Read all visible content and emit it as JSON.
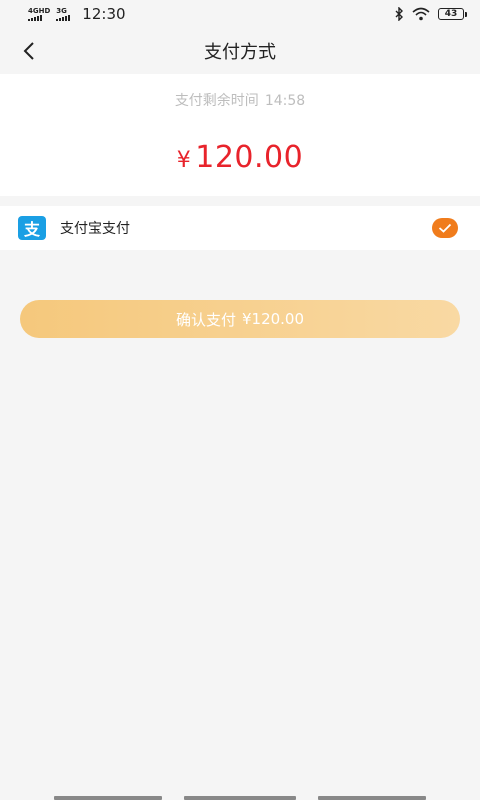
{
  "status_bar": {
    "network_1": "4GHD",
    "network_2": "3G",
    "time": "12:30",
    "battery": "43"
  },
  "navbar": {
    "title": "支付方式",
    "back_icon": "chevron-left-icon"
  },
  "payment": {
    "countdown_label": "支付剩余时间",
    "countdown_value": "14:58",
    "currency_symbol": "¥",
    "amount": "120.00"
  },
  "method": {
    "icon": "alipay-icon",
    "icon_glyph": "支",
    "label": "支付宝支付",
    "selected": true
  },
  "confirm": {
    "label": "确认支付",
    "amount": "¥120.00"
  },
  "colors": {
    "price": "#e8232b",
    "check": "#f07c1c",
    "alipay": "#1a9fe4",
    "button_from": "#f5c87c",
    "button_to": "#f9d9a3"
  }
}
